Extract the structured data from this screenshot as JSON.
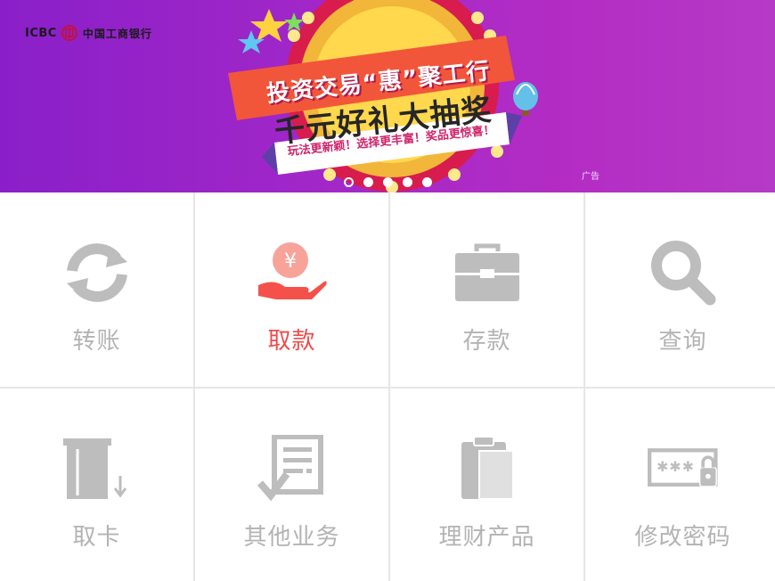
{
  "banner": {
    "logo_en": "ICBC",
    "logo_cn": "中国工商银行",
    "promo_line1": "投资交易“惠”聚工行",
    "promo_line2": "千元好礼大抽奖",
    "promo_line3": "玩法更新颖！选择更丰富！奖品更惊喜！",
    "ad_label": "广告",
    "slide_count": 5,
    "active_slide": 1
  },
  "menu": [
    {
      "label": "转账",
      "icon": "refresh-icon",
      "active": false
    },
    {
      "label": "取款",
      "icon": "coin-hand-icon",
      "active": true
    },
    {
      "label": "存款",
      "icon": "briefcase-icon",
      "active": false
    },
    {
      "label": "查询",
      "icon": "search-icon",
      "active": false
    },
    {
      "label": "取卡",
      "icon": "card-eject-icon",
      "active": false
    },
    {
      "label": "其他业务",
      "icon": "document-check-icon",
      "active": false
    },
    {
      "label": "理财产品",
      "icon": "clipboard-icon",
      "active": false
    },
    {
      "label": "修改密码",
      "icon": "password-lock-icon",
      "active": false
    }
  ],
  "colors": {
    "active_label": "#f04a4a",
    "inactive": "#bdbdbd",
    "banner_purple": "#a428c8"
  }
}
